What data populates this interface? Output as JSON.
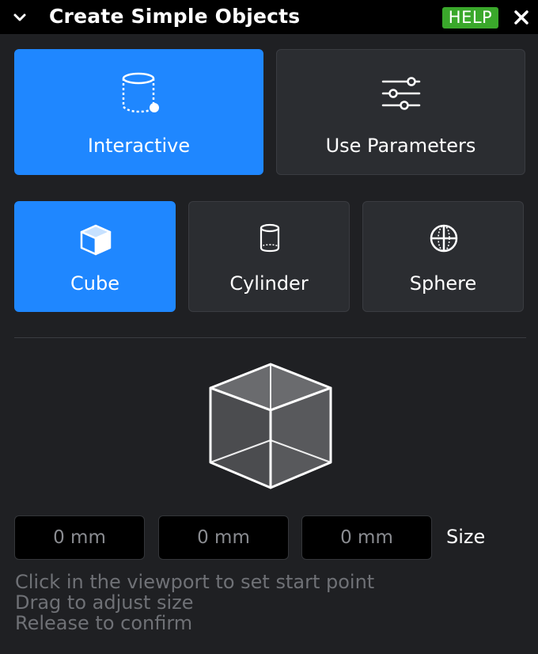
{
  "header": {
    "title": "Create Simple Objects",
    "collapse_icon": "chevron-down-icon",
    "help_label": "HELP",
    "help_color": "#3aa82b",
    "close_icon": "close-icon"
  },
  "modes": [
    {
      "label": "Interactive",
      "icon": "cylinder-drag-icon",
      "active": true
    },
    {
      "label": "Use Parameters",
      "icon": "sliders-icon",
      "active": false
    }
  ],
  "shapes": [
    {
      "label": "Cube",
      "icon": "cube-icon",
      "active": true
    },
    {
      "label": "Cylinder",
      "icon": "cylinder-icon",
      "active": false
    },
    {
      "label": "Sphere",
      "icon": "sphere-icon",
      "active": false
    }
  ],
  "preview": {
    "icon": "cube-preview-icon"
  },
  "dimensions": {
    "fields": [
      {
        "value": "0 mm"
      },
      {
        "value": "0 mm"
      },
      {
        "value": "0 mm"
      }
    ],
    "label": "Size"
  },
  "hints": [
    "Click in the viewport to set start point",
    "Drag to adjust size",
    "Release to confirm"
  ],
  "colors": {
    "accent": "#1f87ff",
    "panel_bg": "#1f2023",
    "button_bg": "#2b2d31",
    "titlebar_bg": "#000000"
  }
}
